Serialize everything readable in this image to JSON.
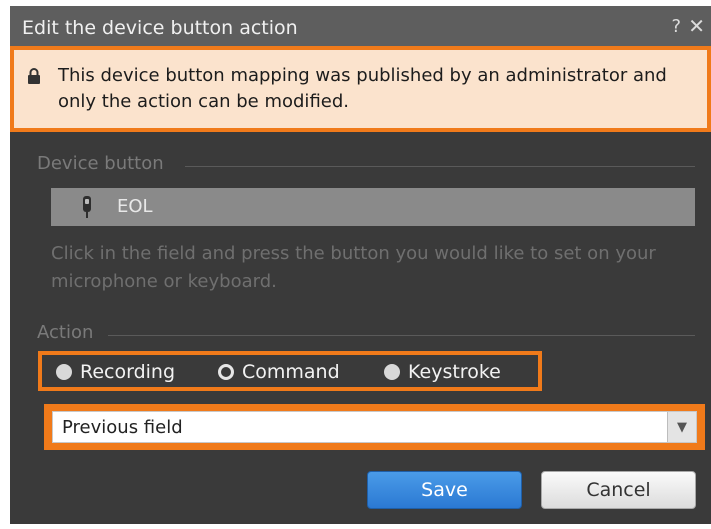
{
  "dialog": {
    "title": "Edit the device button action",
    "help_label": "?",
    "close_label": "✕"
  },
  "banner": {
    "icon": "lock-icon",
    "text": "This device button mapping was published by an administrator and only the action can be modified."
  },
  "device_button": {
    "section_label": "Device button",
    "icon": "microphone-icon",
    "value": "EOL",
    "hint": "Click in the field and press the button you would like to set on your microphone or keyboard."
  },
  "action": {
    "section_label": "Action",
    "options": [
      {
        "label": "Recording",
        "selected": false
      },
      {
        "label": "Command",
        "selected": true
      },
      {
        "label": "Keystroke",
        "selected": false
      }
    ],
    "dropdown_value": "Previous field"
  },
  "buttons": {
    "save": "Save",
    "cancel": "Cancel"
  },
  "colors": {
    "highlight": "#f07a1a",
    "dialog_bg": "#3a3a3a",
    "titlebar": "#5e5e5e",
    "banner_bg": "#fbe3cd",
    "save_button": "#2b79d3"
  }
}
